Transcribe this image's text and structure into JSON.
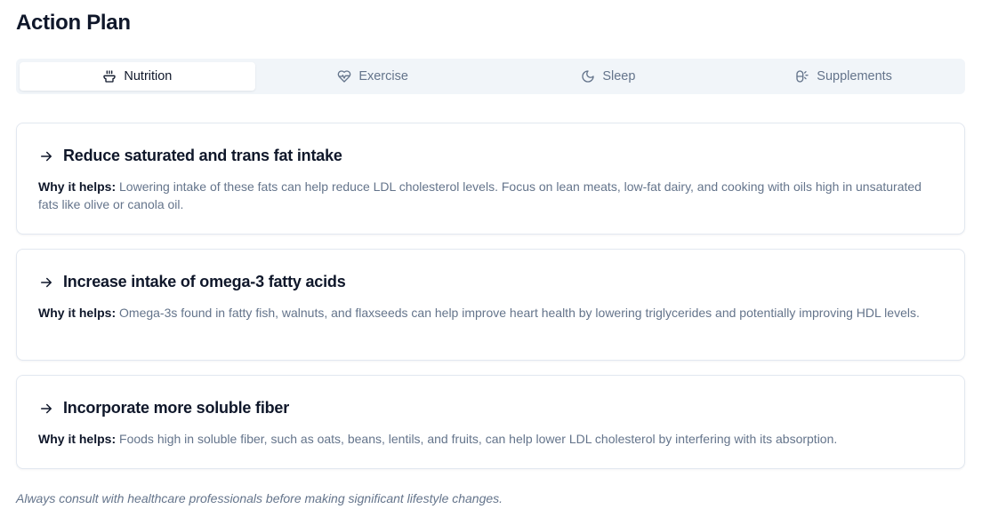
{
  "page": {
    "title": "Action Plan"
  },
  "tabs": [
    {
      "label": "Nutrition",
      "icon": "utensils-icon",
      "active": true
    },
    {
      "label": "Exercise",
      "icon": "heart-pulse-icon",
      "active": false
    },
    {
      "label": "Sleep",
      "icon": "moon-icon",
      "active": false
    },
    {
      "label": "Supplements",
      "icon": "pill-icon",
      "active": false
    }
  ],
  "recommendations": [
    {
      "title": "Reduce saturated and trans fat intake",
      "why_label": "Why it helps:",
      "why_text": "Lowering intake of these fats can help reduce LDL cholesterol levels. Focus on lean meats, low-fat dairy, and cooking with oils high in unsaturated fats like olive or canola oil."
    },
    {
      "title": "Increase intake of omega-3 fatty acids",
      "why_label": "Why it helps:",
      "why_text": "Omega-3s found in fatty fish, walnuts, and flaxseeds can help improve heart health by lowering triglycerides and potentially improving HDL levels."
    },
    {
      "title": "Incorporate more soluble fiber",
      "why_label": "Why it helps:",
      "why_text": "Foods high in soluble fiber, such as oats, beans, lentils, and fruits, can help lower LDL cholesterol by interfering with its absorption."
    }
  ],
  "footnote": "Always consult with healthcare professionals before making significant lifestyle changes.",
  "colors": {
    "text_primary": "#0f172a",
    "text_muted": "#64748b",
    "tab_bar_bg": "#f1f5f9",
    "border": "#e2e8f0"
  }
}
